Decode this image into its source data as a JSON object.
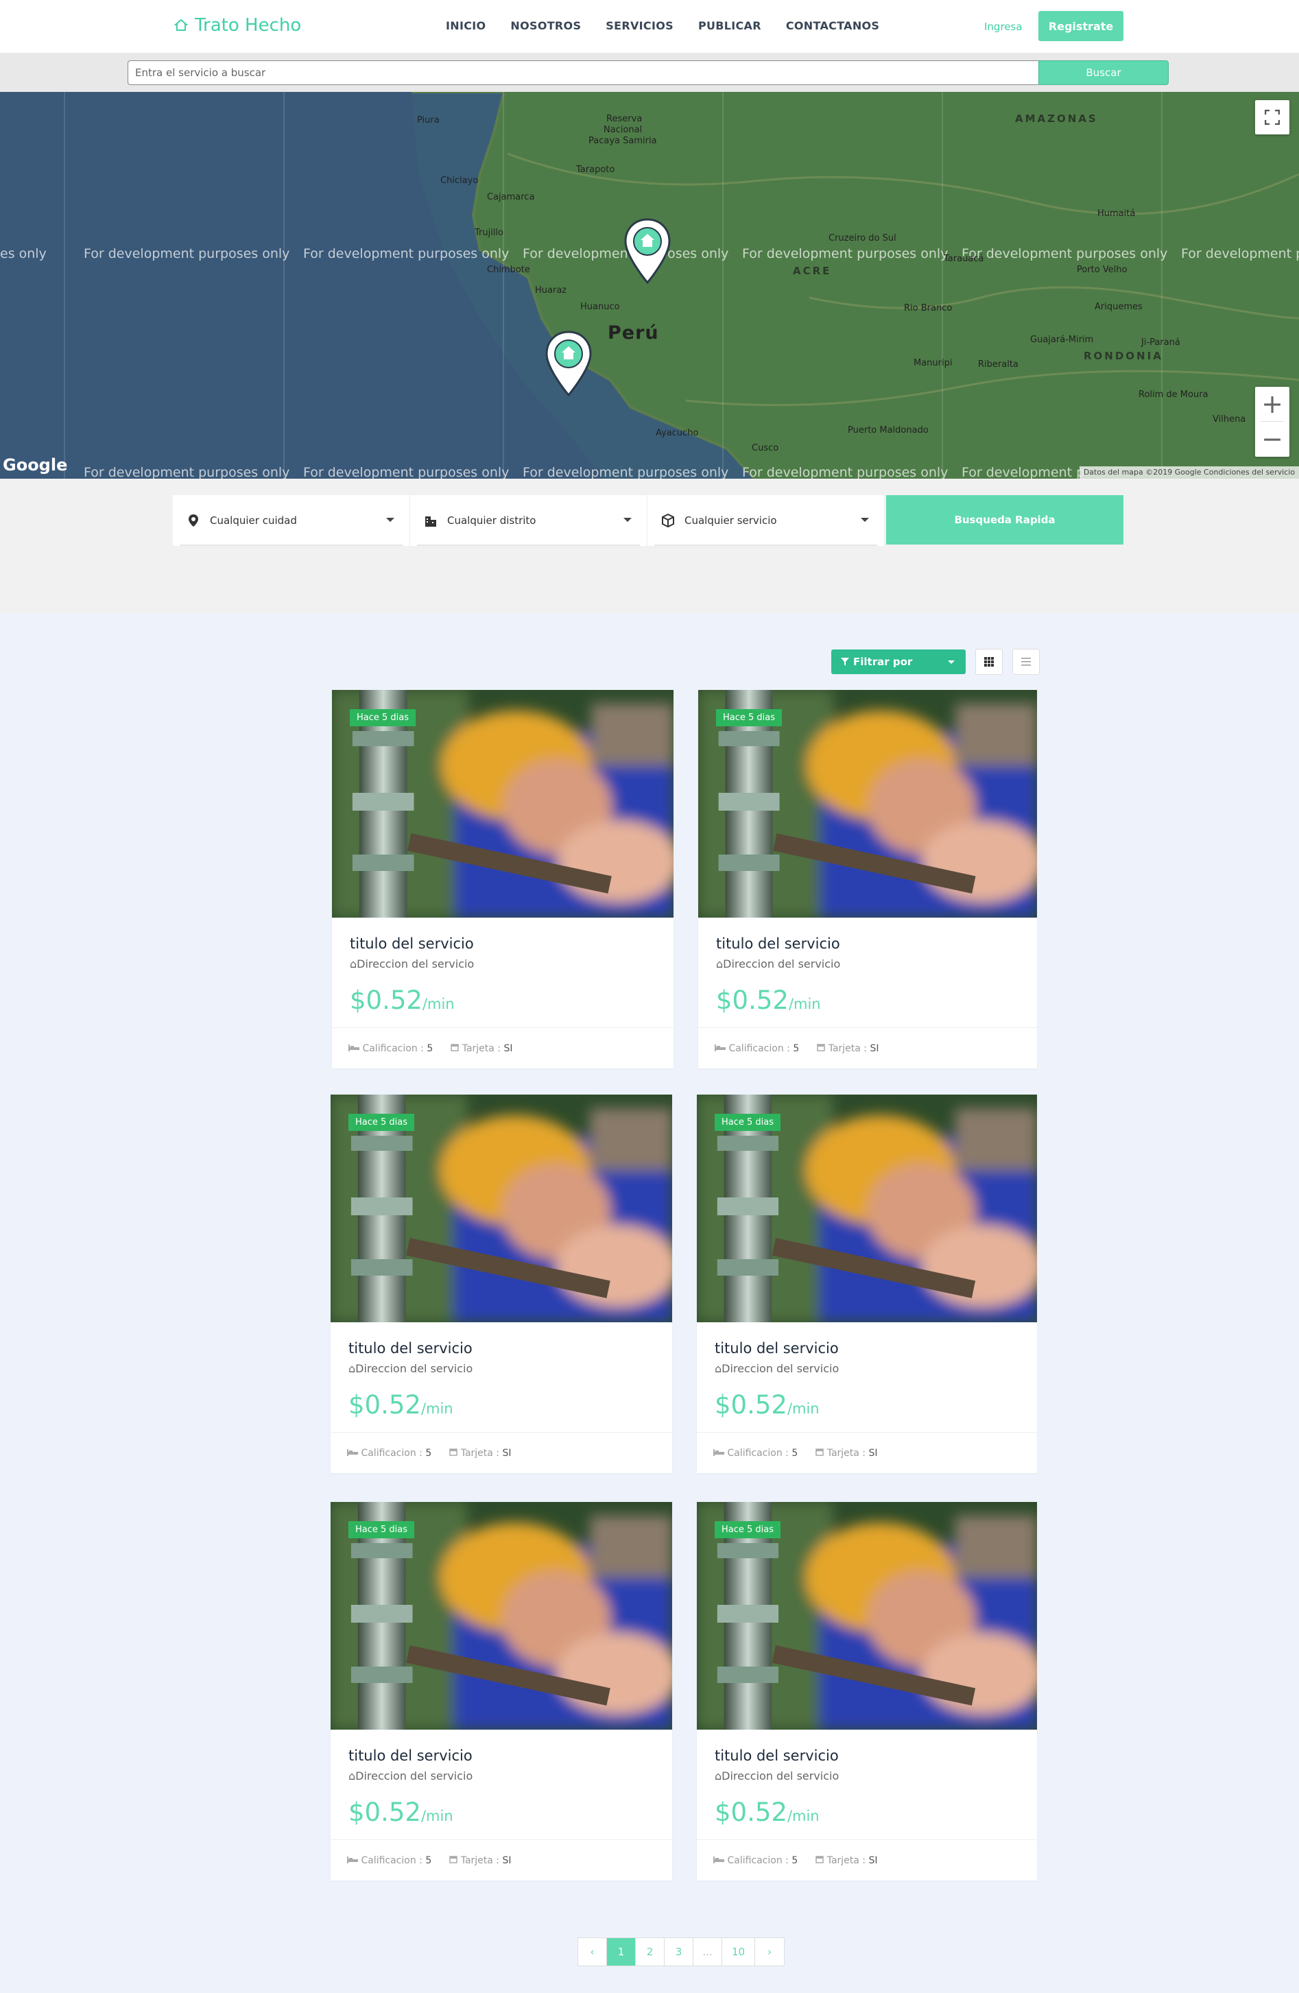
{
  "header": {
    "brand": "Trato Hecho",
    "nav": [
      "INICIO",
      "NOSOTROS",
      "SERVICIOS",
      "PUBLICAR",
      "CONTACTANOS"
    ],
    "login": "Ingresa",
    "register": "Registrate"
  },
  "search": {
    "placeholder": "Entra el servicio a buscar",
    "button": "Buscar"
  },
  "map": {
    "watermark": "For development purposes only",
    "watermark_partial_left": "es only",
    "watermark_partial_right": "For development pu",
    "watermark_partial_cut": "For development p",
    "country": "Perú",
    "places": [
      "Piura",
      "Reserva",
      "Nacional",
      "Pacaya Samiria",
      "Chiclayo",
      "Tarapoto",
      "Cajamarca",
      "Trujillo",
      "Chimbote",
      "Huaraz",
      "Huanuco",
      "Ayacucho",
      "Cusco",
      "Rio Branco",
      "Puerto Maldonado",
      "Manuripi",
      "Riberalta",
      "Guajará-Mirim",
      "Ji-Paraná",
      "Rolim de Moura",
      "Vilhena",
      "Porto Velho",
      "Humaitá",
      "Ariquemes",
      "Cruzeiro do Sul",
      "Tarauacá"
    ],
    "regions": [
      "AMAZONAS",
      "ACRE",
      "RONDONIA"
    ],
    "google": "Google",
    "credit": "Datos del mapa ©2019 Google  Condiciones del servicio"
  },
  "filters": {
    "city": "Cualquier cuidad",
    "district": "Cualquier distrito",
    "service": "Cualquier servicio",
    "quick_search": "Busqueda Rapida"
  },
  "toolbar": {
    "filter_label": "Filtrar por"
  },
  "cards": [
    {
      "badge": "Hace 5 dias",
      "title": "titulo del servicio",
      "address": "Direccion del servicio",
      "price": "$0.52",
      "unit": "/min",
      "rating_label": "Calificacion",
      "rating": "5",
      "card_label": "Tarjeta",
      "card": "SI"
    },
    {
      "badge": "Hace 5 dias",
      "title": "titulo del servicio",
      "address": "Direccion del servicio",
      "price": "$0.52",
      "unit": "/min",
      "rating_label": "Calificacion",
      "rating": "5",
      "card_label": "Tarjeta",
      "card": "SI"
    },
    {
      "badge": "Hace 5 dias",
      "title": "titulo del servicio",
      "address": "Direccion del servicio",
      "price": "$0.52",
      "unit": "/min",
      "rating_label": "Calificacion",
      "rating": "5",
      "card_label": "Tarjeta",
      "card": "SI"
    },
    {
      "badge": "Hace 5 dias",
      "title": "titulo del servicio",
      "address": "Direccion del servicio",
      "price": "$0.52",
      "unit": "/min",
      "rating_label": "Calificacion",
      "rating": "5",
      "card_label": "Tarjeta",
      "card": "SI"
    },
    {
      "badge": "Hace 5 dias",
      "title": "titulo del servicio",
      "address": "Direccion del servicio",
      "price": "$0.52",
      "unit": "/min",
      "rating_label": "Calificacion",
      "rating": "5",
      "card_label": "Tarjeta",
      "card": "SI"
    },
    {
      "badge": "Hace 5 dias",
      "title": "titulo del servicio",
      "address": "Direccion del servicio",
      "price": "$0.52",
      "unit": "/min",
      "rating_label": "Calificacion",
      "rating": "5",
      "card_label": "Tarjeta",
      "card": "SI"
    }
  ],
  "pagination": {
    "prev": "‹",
    "pages": [
      "1",
      "2",
      "3",
      "...",
      "10"
    ],
    "next": "›",
    "current": "1"
  },
  "colors": {
    "accent": "#5ed9b0",
    "badge": "#2db55d",
    "filter_button": "#2dbd8e"
  }
}
